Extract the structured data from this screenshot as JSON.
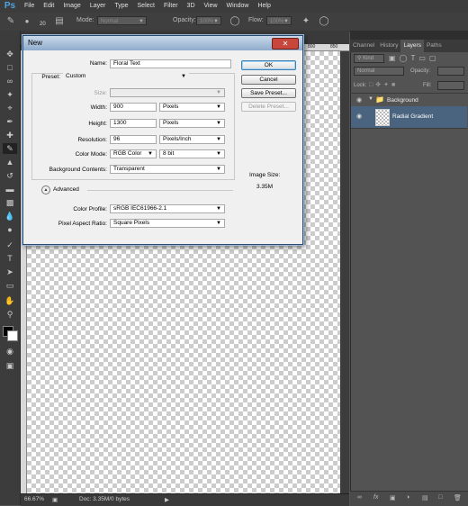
{
  "app": {
    "logo": "Ps",
    "menu": [
      "File",
      "Edit",
      "Image",
      "Layer",
      "Type",
      "Select",
      "Filter",
      "3D",
      "View",
      "Window",
      "Help"
    ]
  },
  "options_bar": {
    "brush_size": "20",
    "mode_label": "Mode:",
    "mode_value": "Normal",
    "opacity_label": "Opacity:",
    "opacity_value": "100%",
    "flow_label": "Flow:",
    "flow_value": "100%"
  },
  "document": {
    "ruler_marks": [
      "800",
      "850"
    ],
    "zoom": "66.67%",
    "doc_info": "Doc: 3.35M/0 bytes"
  },
  "panels": {
    "tabs": [
      "Channel",
      "History",
      "Layers",
      "Paths"
    ],
    "active_tab": "Layers",
    "kind_label": "Kind",
    "blend_mode": "Normal",
    "opacity_label": "Opacity:",
    "lock_label": "Lock:",
    "fill_label": "Fill:",
    "layers": [
      {
        "name": "Background",
        "type": "group"
      },
      {
        "name": "Radial Gradient",
        "type": "layer"
      }
    ],
    "bottom_icons": [
      "link-icon",
      "fx-icon",
      "mask-icon",
      "adjustment-icon",
      "folder-icon",
      "new-layer-icon",
      "trash-icon"
    ]
  },
  "dialog": {
    "title": "New",
    "close": "✕",
    "name_label": "Name:",
    "name_value": "Floral Text",
    "preset_label": "Preset:",
    "preset_value": "Custom",
    "size_label": "Size:",
    "width_label": "Width:",
    "width_value": "900",
    "width_unit": "Pixels",
    "height_label": "Height:",
    "height_value": "1300",
    "height_unit": "Pixels",
    "resolution_label": "Resolution:",
    "resolution_value": "96",
    "resolution_unit": "Pixels/Inch",
    "color_mode_label": "Color Mode:",
    "color_mode_value": "RGB Color",
    "bit_depth_value": "8 bit",
    "bg_contents_label": "Background Contents:",
    "bg_contents_value": "Transparent",
    "advanced_label": "Advanced",
    "color_profile_label": "Color Profile:",
    "color_profile_value": "sRGB IEC61966-2.1",
    "pixel_aspect_label": "Pixel Aspect Ratio:",
    "pixel_aspect_value": "Square Pixels",
    "image_size_label": "Image Size:",
    "image_size_value": "3.35M",
    "ok_label": "OK",
    "cancel_label": "Cancel",
    "save_preset_label": "Save Preset...",
    "delete_preset_label": "Delete Preset..."
  }
}
